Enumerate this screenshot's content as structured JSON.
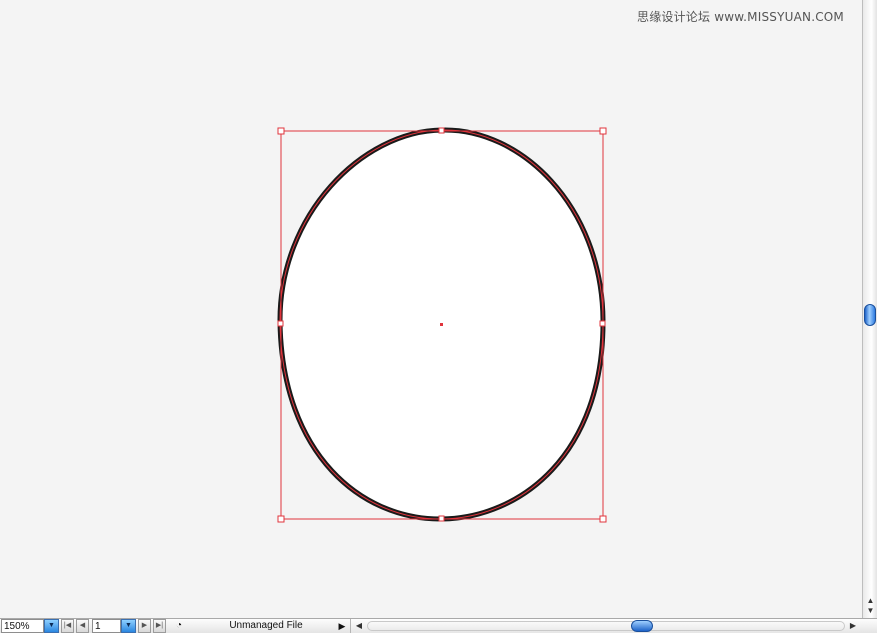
{
  "watermark": "思缘设计论坛 www.MISSYUAN.COM",
  "status_bar": {
    "zoom_value": "150%",
    "page_value": "1",
    "status_text": "Unmanaged File"
  },
  "colors": {
    "selection": "#e0343c",
    "shape_stroke": "#1a1a1a",
    "shape_fill": "#ffffff",
    "artboard": "#f4f4f4",
    "scroll_thumb": "#2a7be0"
  },
  "icons": {
    "zoom_dropdown": "chevron-down-icon",
    "first_page": "first-page-icon",
    "prev_page": "prev-page-icon",
    "page_dropdown": "chevron-down-icon",
    "next_page": "next-page-icon",
    "last_page": "last-page-icon",
    "status_menu": "triangle-right-icon"
  }
}
